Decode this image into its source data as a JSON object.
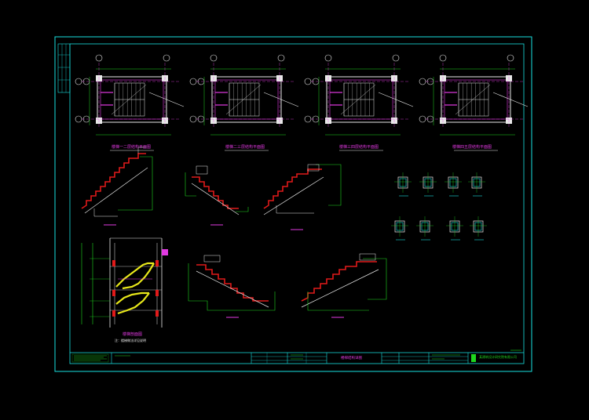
{
  "plan_titles": [
    "楼梯一二层结构平面图",
    "楼梯二三层结构平面图",
    "楼梯三四层结构平面图",
    "楼梯四五层结构平面图"
  ],
  "section_title": "楼梯剖面图",
  "section_note": "注：楼梯做法详见说明",
  "title_block": {
    "drawing_name": "楼梯结构详图",
    "company": "某建筑设计研究院有限公司"
  },
  "colors": {
    "frame": "#19e0e0",
    "lines": "#e8e8e8",
    "dims": "#1ed61e",
    "labels": "#e23ae2",
    "steps": "#e01a1a",
    "rebar": "#e8e81a"
  }
}
